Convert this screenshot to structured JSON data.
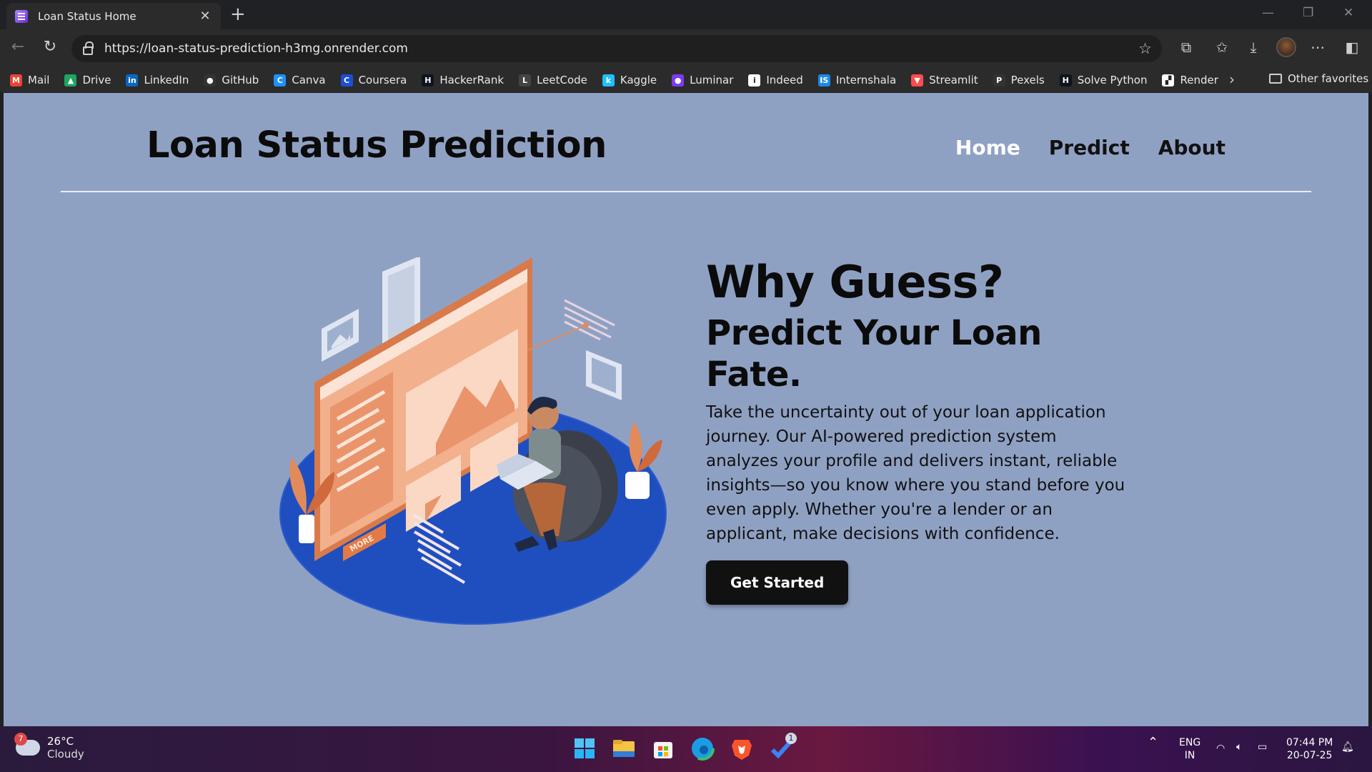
{
  "browser": {
    "tab_title": "Loan Status Home",
    "url": "https://loan-status-prediction-h3mg.onrender.com",
    "bookmarks": [
      {
        "label": "Mail",
        "color": "#ea4335",
        "glyph": "M"
      },
      {
        "label": "Drive",
        "color": "#1fa463",
        "glyph": "▲"
      },
      {
        "label": "LinkedIn",
        "color": "#0a66c2",
        "glyph": "in"
      },
      {
        "label": "GitHub",
        "color": "#333333",
        "glyph": "●"
      },
      {
        "label": "Canva",
        "color": "#1e90ff",
        "glyph": "C"
      },
      {
        "label": "Coursera",
        "color": "#1d4ed8",
        "glyph": "C"
      },
      {
        "label": "HackerRank",
        "color": "#0e141e",
        "glyph": "H"
      },
      {
        "label": "LeetCode",
        "color": "#444444",
        "glyph": "L"
      },
      {
        "label": "Kaggle",
        "color": "#20beff",
        "glyph": "k"
      },
      {
        "label": "Luminar",
        "color": "#7c3aed",
        "glyph": "●"
      },
      {
        "label": "Indeed",
        "color": "#ffffff",
        "glyph": "i"
      },
      {
        "label": "Internshala",
        "color": "#1e88e5",
        "glyph": "IS"
      },
      {
        "label": "Streamlit",
        "color": "#ff4b4b",
        "glyph": "▼"
      },
      {
        "label": "Pexels",
        "color": "#333333",
        "glyph": "P"
      },
      {
        "label": "Solve Python",
        "color": "#0e141e",
        "glyph": "H"
      },
      {
        "label": "Render",
        "color": "#ffffff",
        "glyph": "▞"
      }
    ],
    "other_favorites": "Other favorites"
  },
  "site": {
    "title": "Loan Status Prediction",
    "nav": {
      "home": "Home",
      "predict": "Predict",
      "about": "About"
    },
    "hero": {
      "headline": "Why Guess?",
      "subheadline": "Predict Your Loan Fate.",
      "body": "Take the uncertainty out of your loan application journey. Our AI-powered prediction system analyzes your profile and delivers instant, reliable insights—so you know where you stand before you even apply. Whether you're a lender or an applicant, make decisions with confidence.",
      "cta": "Get Started",
      "illustration_label": "MORE"
    },
    "colors": {
      "background": "#8fa1c3",
      "active_nav": "#ffffff",
      "accent_blue": "#1f4fbf",
      "accent_orange": "#e8956a"
    }
  },
  "taskbar": {
    "weather": {
      "badge": "7",
      "temp": "26°C",
      "condition": "Cloudy"
    },
    "tray": {
      "lang_1": "ENG",
      "lang_2": "IN",
      "time": "07:44 PM",
      "date": "20-07-25"
    },
    "todo_badge": "1"
  }
}
